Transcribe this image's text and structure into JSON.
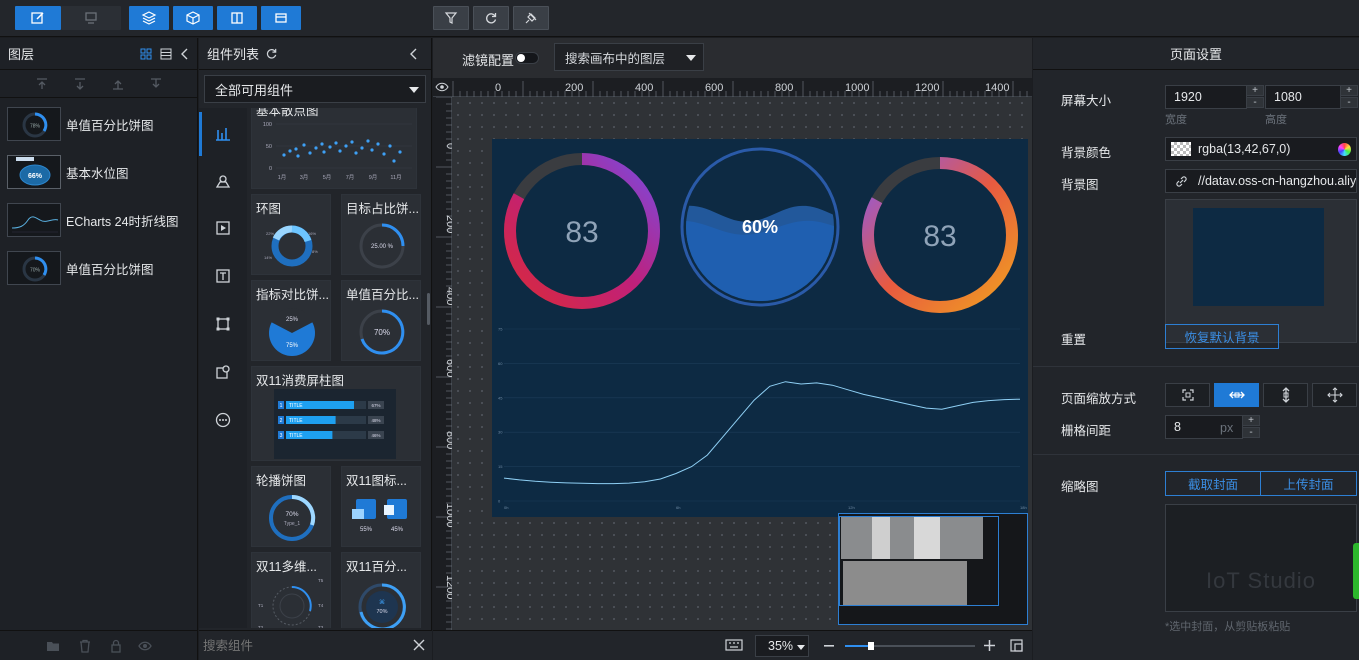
{
  "layers_panel": {
    "title": "图层",
    "items": [
      {
        "label": "单值百分比饼图"
      },
      {
        "label": "基本水位图"
      },
      {
        "label": "ECharts 24时折线图"
      },
      {
        "label": "单值百分比饼图"
      }
    ]
  },
  "component_panel": {
    "title": "组件列表",
    "filter_select": "全部可用组件",
    "search_placeholder": "搜索组件",
    "cards": [
      {
        "title": "基本散点图"
      },
      {
        "title": "环图"
      },
      {
        "title": "目标占比饼..."
      },
      {
        "title": "指标对比饼..."
      },
      {
        "title": "单值百分比..."
      },
      {
        "title": "双11消费屏柱图"
      },
      {
        "title": "轮播饼图"
      },
      {
        "title": "双11图标..."
      },
      {
        "title": "双11多维..."
      },
      {
        "title": "双11百分..."
      }
    ],
    "previews": {
      "scatter_y_ticks": [
        "100",
        "50",
        "0"
      ],
      "scatter_x_ticks": [
        "1月",
        "3月",
        "5月",
        "7月",
        "9月",
        "11月"
      ],
      "donut_center_text": "25.00 %",
      "compare_top": "25%",
      "compare_bottom": "75%",
      "single_value": "70%",
      "bar_rows": [
        {
          "idx": "1",
          "label": "TITLE",
          "value": "67%",
          "fill": 0.85
        },
        {
          "idx": "2",
          "label": "TITLE",
          "value": "48%",
          "fill": 0.62
        },
        {
          "idx": "3",
          "label": "TITLE",
          "value": "46%",
          "fill": 0.58
        }
      ],
      "carousel_value": "70%",
      "carousel_sub": "Type_1",
      "icon_left": "55%",
      "icon_right": "45%",
      "radar_labels": [
        "T5",
        "T1",
        "T4",
        "T2",
        "T3"
      ],
      "percent_value": "70%"
    }
  },
  "canvas_toolbar": {
    "filter_label": "滤镜配置",
    "search_placeholder": "搜索画布中的图层"
  },
  "ruler": {
    "h_ticks": [
      "0",
      "200",
      "400",
      "600",
      "800",
      "1000",
      "1200",
      "1400"
    ],
    "v_ticks": [
      "0",
      "200",
      "400",
      "600",
      "800",
      "1000",
      "1200"
    ]
  },
  "screen": {
    "gauge_left_value": "83",
    "water_value": "60%",
    "gauge_right_value": "83",
    "gauge_left_fill": 0.83,
    "gauge_right_fill": 0.83,
    "water_level": 0.6,
    "line_y_ticks": [
      "75",
      "60",
      "45",
      "30",
      "15",
      "0"
    ],
    "line_x_ticks": [
      "0h",
      "6h",
      "12h",
      "18h"
    ],
    "line_series": [
      10,
      9.2,
      8.6,
      8.2,
      7.9,
      7.7,
      7.6,
      7.6,
      7.8,
      8.4,
      9.6,
      12,
      15,
      20,
      28,
      36,
      44,
      50,
      52,
      51,
      51.5,
      50.5,
      48.5,
      46.5,
      45,
      43.5,
      42,
      40.5,
      40,
      41.5,
      43,
      43.8,
      44.2,
      44.4
    ]
  },
  "bottom_bar": {
    "zoom": "35%",
    "zoom_fraction": 0.2
  },
  "page_settings": {
    "title": "页面设置",
    "screen_size_label": "屏幕大小",
    "width": "1920",
    "height": "1080",
    "width_label": "宽度",
    "height_label": "高度",
    "bg_color_label": "背景颜色",
    "bg_color": "rgba(13,42,67,0)",
    "bg_image_label": "背景图",
    "bg_image_url": "//datav.oss-cn-hangzhou.aliyu",
    "reset_label": "重置",
    "reset_button": "恢复默认背景",
    "scale_label": "页面缩放方式",
    "grid_label": "栅格间距",
    "grid_value": "8",
    "grid_unit": "px",
    "thumbnail_label": "缩略图",
    "capture_button": "截取封面",
    "upload_button": "上传封面",
    "thumbnail_watermark": "IoT Studio",
    "thumbnail_hint": "*选中封面，从剪贴板粘贴"
  },
  "colors": {
    "accent": "#1f7ad6",
    "screen_bg": "#0d2a43",
    "panel_bg": "#22252a"
  }
}
